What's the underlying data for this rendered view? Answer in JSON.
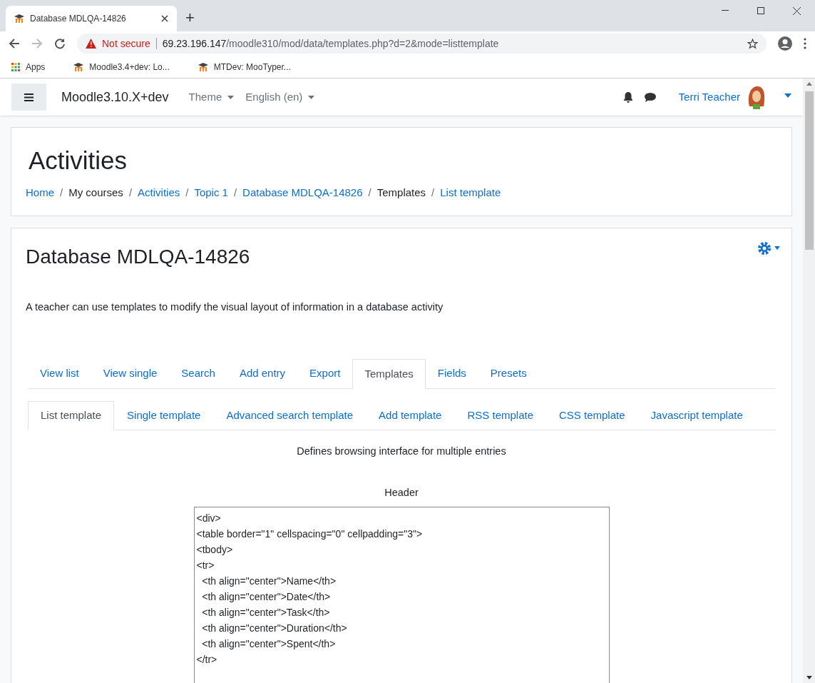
{
  "browser": {
    "tab_title": "Database MDLQA-14826",
    "new_tab": "+",
    "security": "Not secure",
    "url_host": "69.23.196.147",
    "url_path": "/moodle310/mod/data/templates.php?d=2&mode=listtemplate",
    "bookmarks": [
      {
        "label": "Apps",
        "kind": "apps"
      },
      {
        "label": "Moodle3.4+dev: Lo...",
        "kind": "site"
      },
      {
        "label": "MTDev: MooTyper...",
        "kind": "site"
      }
    ]
  },
  "navbar": {
    "site_name": "Moodle3.10.X+dev",
    "menus": [
      "Theme",
      "English (en)"
    ],
    "user_name": "Terri Teacher"
  },
  "header": {
    "title": "Activities",
    "separator": "/",
    "breadcrumbs": [
      {
        "label": "Home",
        "link": true
      },
      {
        "label": "My courses",
        "link": false
      },
      {
        "label": "Activities",
        "link": true
      },
      {
        "label": "Topic 1",
        "link": true
      },
      {
        "label": "Database MDLQA-14826",
        "link": true
      },
      {
        "label": "Templates",
        "link": false
      },
      {
        "label": "List template",
        "link": true
      }
    ]
  },
  "activity": {
    "title": "Database MDLQA-14826",
    "description": "A teacher can use templates to modify the visual layout of information in a database activity",
    "tabs": [
      {
        "label": "View list",
        "selected": false
      },
      {
        "label": "View single",
        "selected": false
      },
      {
        "label": "Search",
        "selected": false
      },
      {
        "label": "Add entry",
        "selected": false
      },
      {
        "label": "Export",
        "selected": false
      },
      {
        "label": "Templates",
        "selected": true
      },
      {
        "label": "Fields",
        "selected": false
      },
      {
        "label": "Presets",
        "selected": false
      }
    ],
    "subtabs": [
      {
        "label": "List template",
        "selected": true
      },
      {
        "label": "Single template",
        "selected": false
      },
      {
        "label": "Advanced search template",
        "selected": false
      },
      {
        "label": "Add template",
        "selected": false
      },
      {
        "label": "RSS template",
        "selected": false
      },
      {
        "label": "CSS template",
        "selected": false
      },
      {
        "label": "Javascript template",
        "selected": false
      }
    ],
    "template_description": "Defines browsing interface for multiple entries",
    "header_label": "Header",
    "header_value": "<div>\n<table border=\"1\" cellspacing=\"0\" cellpadding=\"3\">\n<tbody>\n<tr>\n  <th align=\"center\">Name</th>\n  <th align=\"center\">Date</th>\n  <th align=\"center\">Task</th>\n  <th align=\"center\">Duration</th>\n  <th align=\"center\">Spent</th>\n</tr>"
  }
}
